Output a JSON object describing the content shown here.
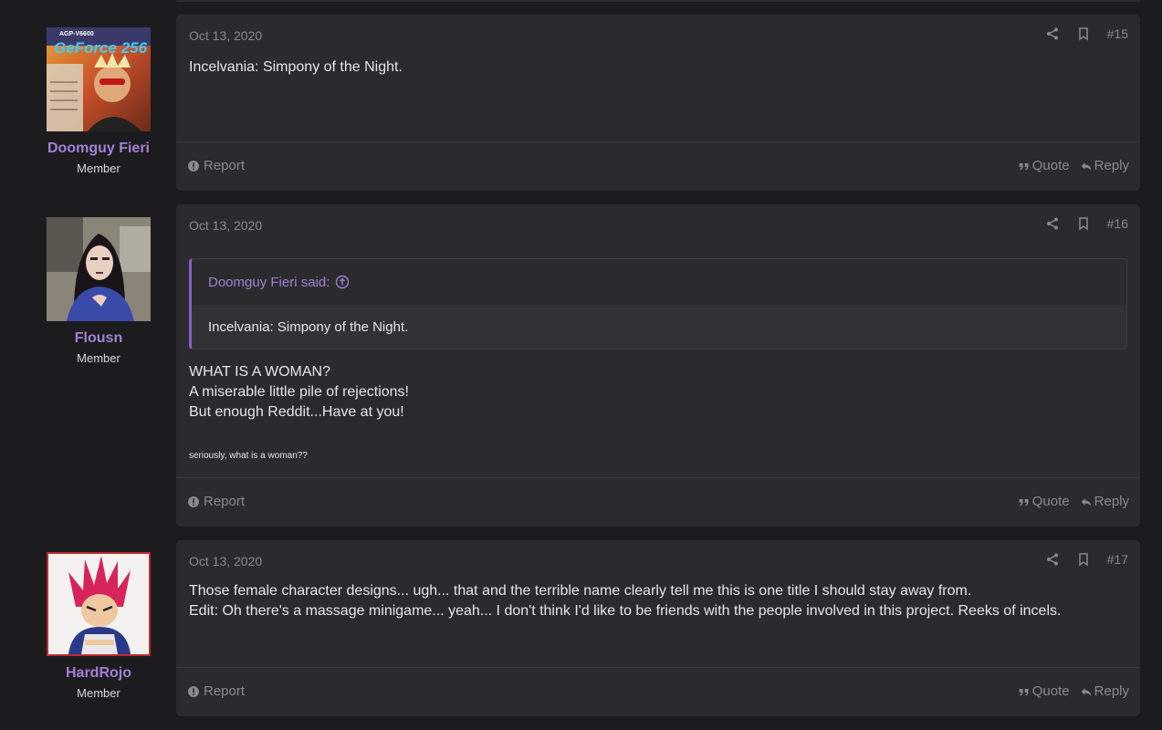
{
  "posts": [
    {
      "user": {
        "name": "Doomguy Fieri",
        "role": "Member"
      },
      "date": "Oct 13, 2020",
      "number": "#15",
      "body_lines": [
        "Incelvania: Simpony of the Night."
      ],
      "footer": {
        "report": "Report",
        "quote": "Quote",
        "reply": "Reply"
      }
    },
    {
      "user": {
        "name": "Flousn",
        "role": "Member"
      },
      "date": "Oct 13, 2020",
      "number": "#16",
      "quote": {
        "author": "Doomguy Fieri said:",
        "text": "Incelvania: Simpony of the Night."
      },
      "body_lines": [
        "WHAT IS A WOMAN?",
        "A miserable little pile of rejections!",
        "But enough Reddit...Have at you!"
      ],
      "small_line": "seriously, what is a woman??",
      "footer": {
        "report": "Report",
        "quote": "Quote",
        "reply": "Reply"
      }
    },
    {
      "user": {
        "name": "HardRojo",
        "role": "Member"
      },
      "date": "Oct 13, 2020",
      "number": "#17",
      "body_lines": [
        "Those female character designs... ugh... that and the terrible name clearly tell me this is one title I should stay away from.",
        "Edit: Oh there's a massage minigame... yeah... I don't think I'd like to be friends with the people involved in this project. Reeks of incels."
      ],
      "footer": {
        "report": "Report",
        "quote": "Quote",
        "reply": "Reply"
      }
    }
  ],
  "avatar_text": {
    "gpu_box": "AGP-V6600",
    "gpu_brand": "GeForce 256"
  },
  "colors": {
    "background": "#1c1c1e",
    "card": "#2b2b2e",
    "accent": "#a47fd6",
    "muted": "#8a8a8e"
  }
}
